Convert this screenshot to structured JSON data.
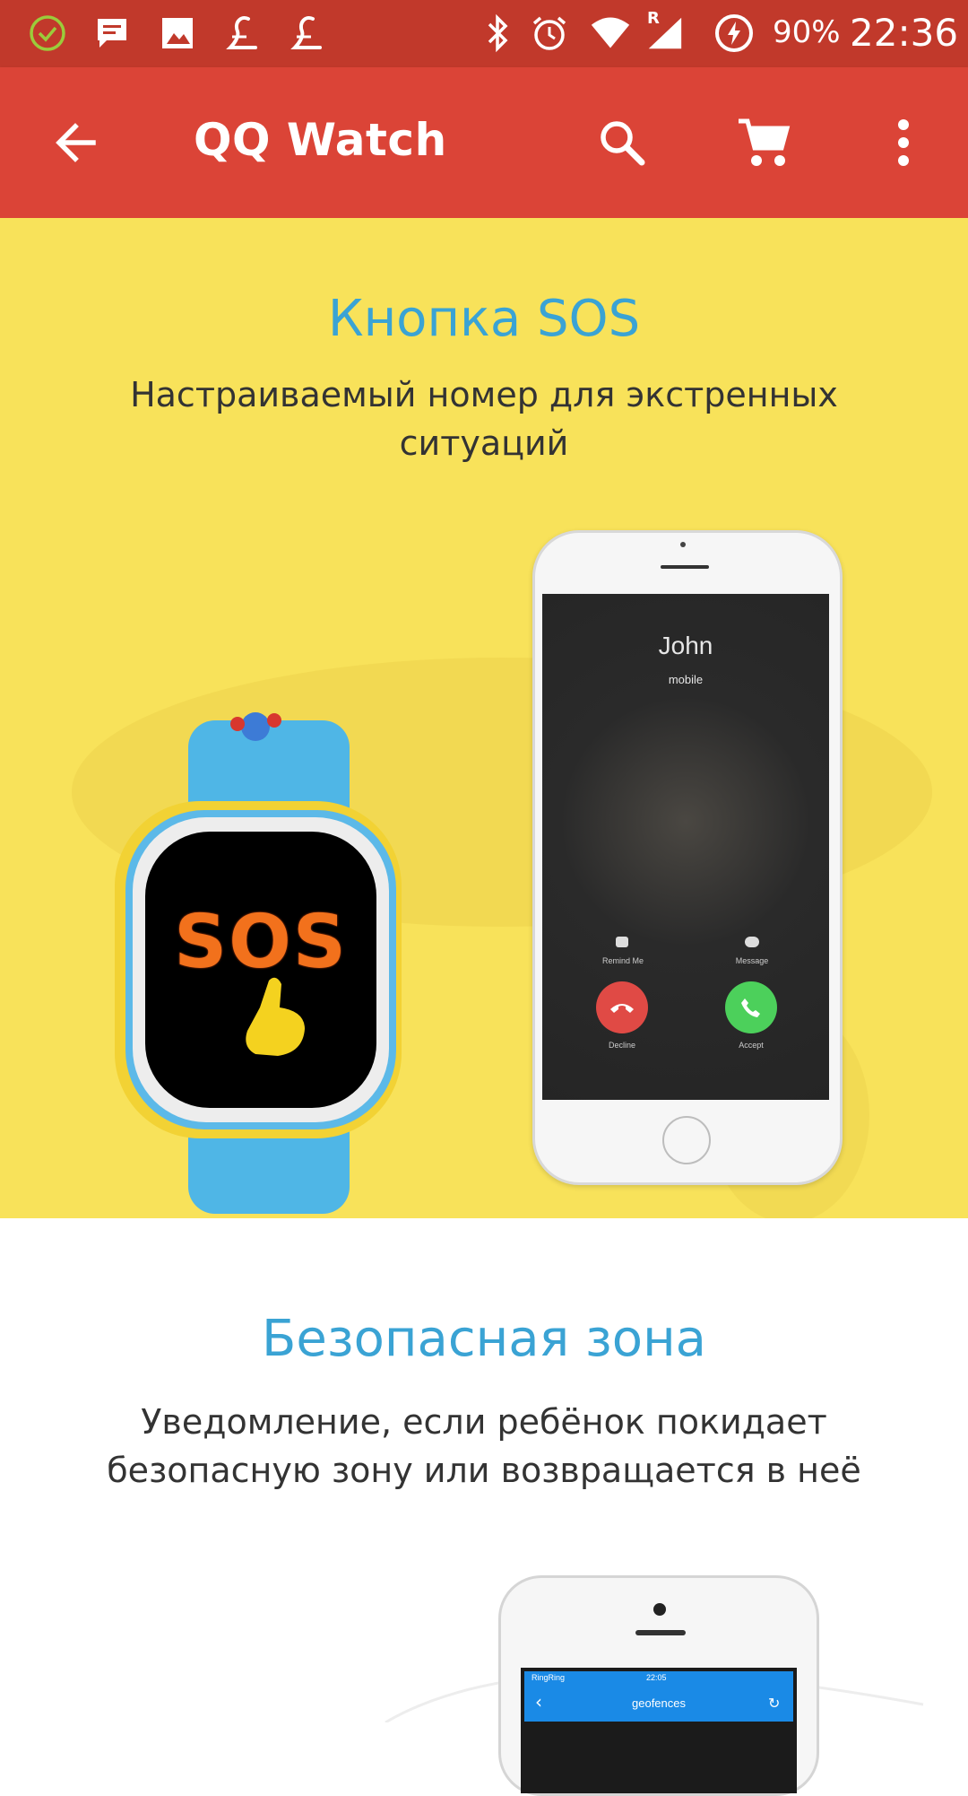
{
  "status_bar": {
    "battery": "90%",
    "time": "22:36",
    "roaming": "R",
    "icons": [
      "check-circle-icon",
      "message-icon",
      "image-icon",
      "app-l-icon",
      "app-l-icon",
      "bluetooth-icon",
      "alarm-icon",
      "wifi-icon",
      "signal-icon",
      "battery-charging-icon"
    ]
  },
  "app_bar": {
    "title": "QQ Watch",
    "icons": [
      "back-arrow-icon",
      "search-icon",
      "cart-icon",
      "more-vert-icon"
    ]
  },
  "hero": {
    "title": "Кнопка SOS",
    "subtitle": "Настраиваемый номер для экстренных ситуаций",
    "watch_screen_text": "SOS",
    "phone": {
      "caller": "John",
      "caller_type": "mobile",
      "remind_label": "Remind Me",
      "message_label": "Message",
      "decline_label": "Decline",
      "accept_label": "Accept"
    }
  },
  "section2": {
    "title": "Безопасная зона",
    "subtitle": "Уведомление, если ребёнок покидает безопасную зону или возвращается в неё",
    "phone": {
      "carrier": "RingRing",
      "time": "22:05",
      "screen_title": "geofences"
    }
  },
  "colors": {
    "status_bar": "#C1392B",
    "app_bar": "#DB4437",
    "hero_bg": "#F8E25A",
    "heading": "#3AA3D4"
  }
}
